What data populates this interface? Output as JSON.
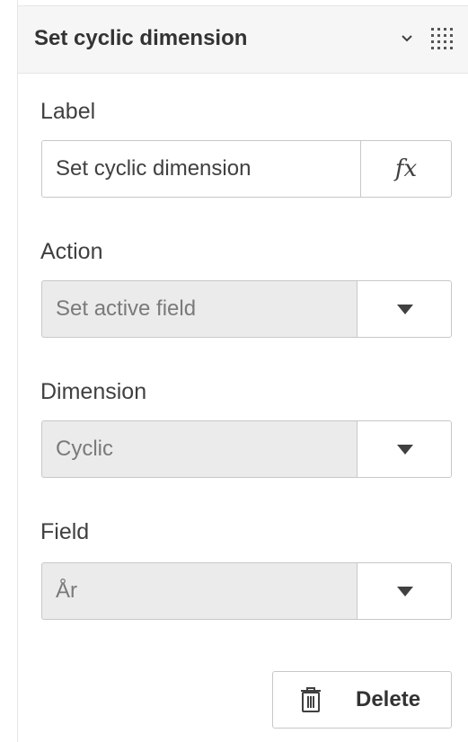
{
  "panel": {
    "title": "Set cyclic dimension",
    "header_icons": [
      "chevron-down-icon",
      "drag-handle-icon"
    ]
  },
  "label_field": {
    "label": "Label",
    "value": "Set cyclic dimension",
    "expression_button": "fx"
  },
  "action_field": {
    "label": "Action",
    "value": "Set active field"
  },
  "dimension_field": {
    "label": "Dimension",
    "value": "Cyclic"
  },
  "field_field": {
    "label": "Field",
    "value": "År"
  },
  "delete_button": {
    "label": "Delete",
    "icon": "trash-icon"
  },
  "colors": {
    "header_bg": "#f6f6f6",
    "disabled_bg": "#ebebeb",
    "border": "#c8c8c8",
    "text": "#404040"
  }
}
